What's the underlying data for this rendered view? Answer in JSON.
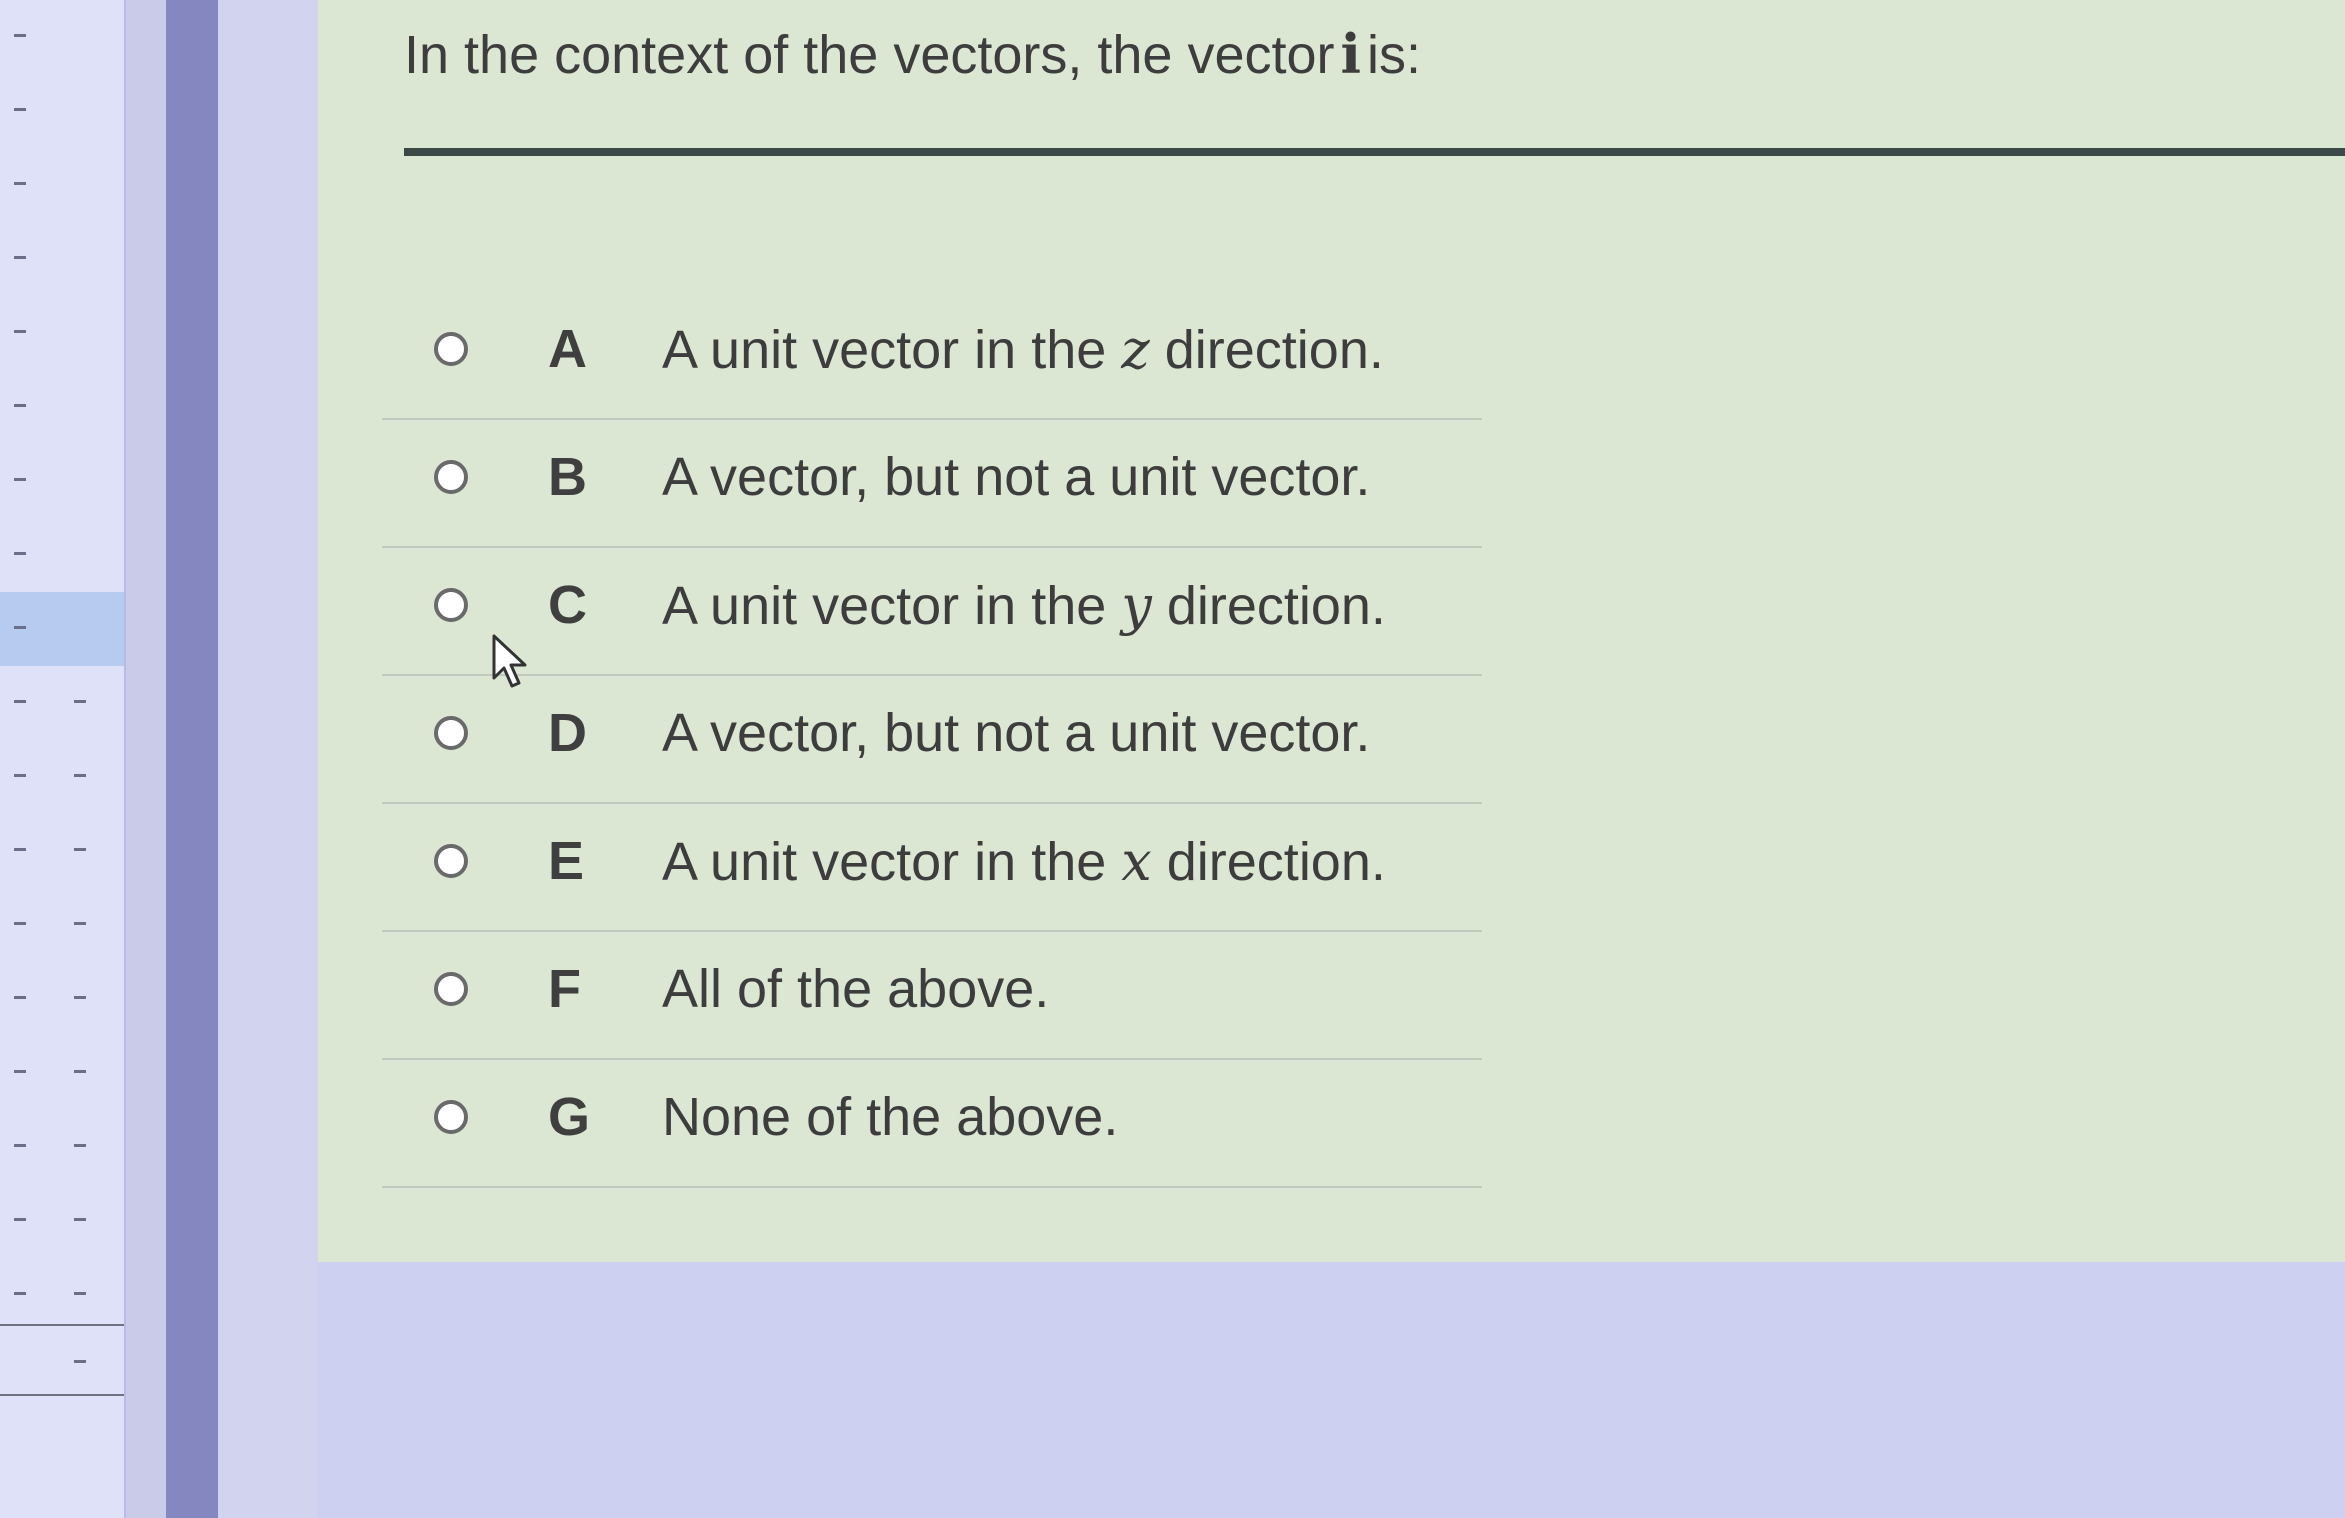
{
  "question": {
    "prefix": "In the context of the vectors, the vector",
    "symbol": "i",
    "suffix": "is:"
  },
  "options": [
    {
      "letter": "A",
      "text_before": "A unit vector in the",
      "math": "z",
      "text_after": "direction."
    },
    {
      "letter": "B",
      "text_before": "A vector, but not a unit vector.",
      "math": "",
      "text_after": ""
    },
    {
      "letter": "C",
      "text_before": "A unit vector in the",
      "math": "y",
      "text_after": "direction."
    },
    {
      "letter": "D",
      "text_before": "A vector, but not a unit vector.",
      "math": "",
      "text_after": ""
    },
    {
      "letter": "E",
      "text_before": "A unit vector in the",
      "math": "x",
      "text_after": "direction."
    },
    {
      "letter": "F",
      "text_before": "All of the above.",
      "math": "",
      "text_after": ""
    },
    {
      "letter": "G",
      "text_before": "None of the above.",
      "math": "",
      "text_after": ""
    }
  ],
  "colors": {
    "card_background": "#dbe6d3",
    "page_background": "#c9cbe9",
    "sidebar_background": "#dfe1f8",
    "sidebar_accent": "#8587c1",
    "title_rule": "#3c4a45"
  },
  "icons": {
    "radio": "radio-button-icon",
    "cursor": "mouse-pointer-icon"
  }
}
